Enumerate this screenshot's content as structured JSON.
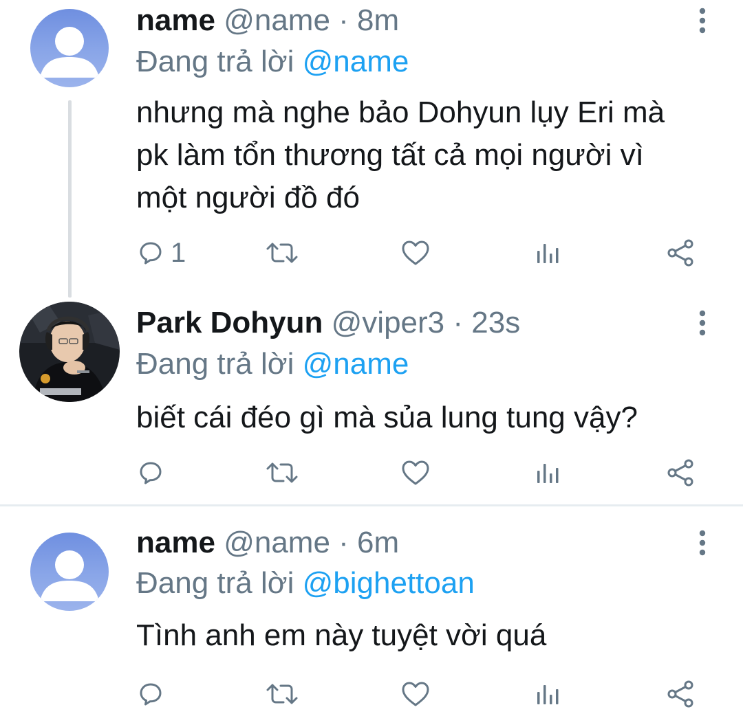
{
  "tweets": [
    {
      "display_name": "name",
      "handle": "@name",
      "separator": "·",
      "time": "8m",
      "reply_prefix": "Đang trả lời",
      "reply_to": "@name",
      "text": "nhưng mà nghe bảo Dohyun lụy Eri mà pk làm tổn thương tất cả mọi người vì một người đồ đó",
      "reply_count": "1",
      "avatar": "default-avatar"
    },
    {
      "display_name": "Park Dohyun",
      "handle": "@viper3",
      "separator": "·",
      "time": "23s",
      "reply_prefix": "Đang trả lời",
      "reply_to": "@name",
      "text": "biết cái đéo gì mà sủa lung tung vậy?",
      "reply_count": "",
      "avatar": "photo-avatar"
    },
    {
      "display_name": "name",
      "handle": "@name",
      "separator": "·",
      "time": "6m",
      "reply_prefix": "Đang trả lời",
      "reply_to": "@bighettoan",
      "text": "Tình anh em này tuyệt vời quá",
      "reply_count": "",
      "avatar": "default-avatar"
    }
  ],
  "icons": {
    "reply": "reply-icon",
    "retweet": "retweet-icon",
    "like": "heart-icon",
    "analytics": "analytics-icon",
    "share": "share-icon",
    "more": "more-vertical-icon"
  },
  "colors": {
    "mention": "#1da1f2",
    "secondary_text": "#657786",
    "primary_text": "#14171a",
    "thread_line": "#d9dde1",
    "avatar_default": "#7f9ae6"
  }
}
